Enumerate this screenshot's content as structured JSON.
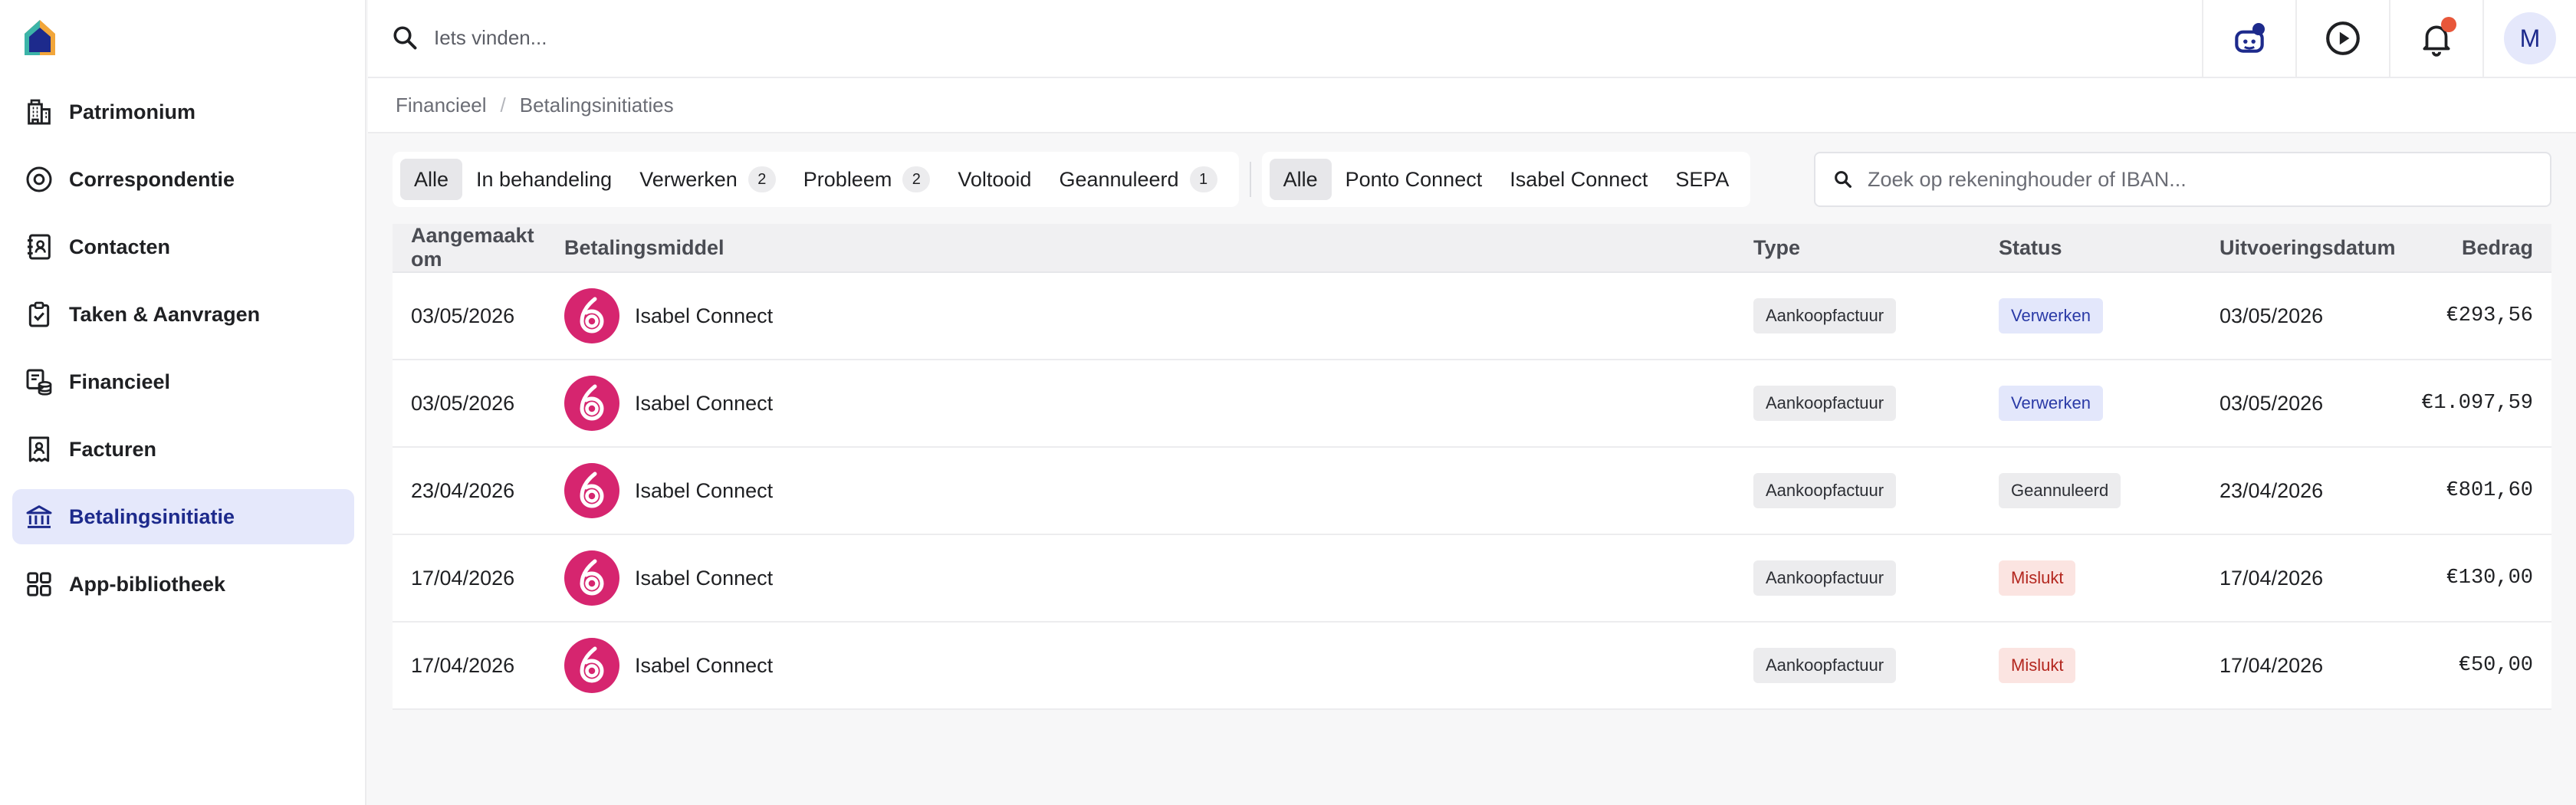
{
  "topbar": {
    "search_placeholder": "Iets vinden...",
    "avatar_initial": "M"
  },
  "sidebar": {
    "items": [
      {
        "label": "Patrimonium",
        "icon": "building-icon",
        "active": false
      },
      {
        "label": "Correspondentie",
        "icon": "at-sign-icon",
        "active": false
      },
      {
        "label": "Contacten",
        "icon": "contact-book-icon",
        "active": false
      },
      {
        "label": "Taken & Aanvragen",
        "icon": "clipboard-check-icon",
        "active": false
      },
      {
        "label": "Financieel",
        "icon": "coins-icon",
        "active": false
      },
      {
        "label": "Facturen",
        "icon": "invoice-icon",
        "active": false
      },
      {
        "label": "Betalingsinitiatie",
        "icon": "bank-icon",
        "active": true
      },
      {
        "label": "App-bibliotheek",
        "icon": "grid-icon",
        "active": false
      }
    ]
  },
  "breadcrumb": {
    "parent": "Financieel",
    "separator": "/",
    "current": "Betalingsinitiaties"
  },
  "filters": {
    "status": [
      {
        "label": "Alle",
        "count": null,
        "selected": true
      },
      {
        "label": "In behandeling",
        "count": null,
        "selected": false
      },
      {
        "label": "Verwerken",
        "count": "2",
        "selected": false
      },
      {
        "label": "Probleem",
        "count": "2",
        "selected": false
      },
      {
        "label": "Voltooid",
        "count": null,
        "selected": false
      },
      {
        "label": "Geannuleerd",
        "count": "1",
        "selected": false
      }
    ],
    "provider": [
      {
        "label": "Alle",
        "selected": true
      },
      {
        "label": "Ponto Connect",
        "selected": false
      },
      {
        "label": "Isabel Connect",
        "selected": false
      },
      {
        "label": "SEPA",
        "selected": false
      }
    ],
    "search_placeholder": "Zoek op rekeninghouder of IBAN..."
  },
  "table": {
    "columns": [
      "Aangemaakt om",
      "Betalingsmiddel",
      "Type",
      "Status",
      "Uitvoeringsdatum",
      "Bedrag"
    ],
    "rows": [
      {
        "created": "03/05/2026",
        "method": "Isabel Connect",
        "type": "Aankoopfactuur",
        "status": "Verwerken",
        "status_kind": "processing",
        "execution_date": "03/05/2026",
        "amount": "€293,56"
      },
      {
        "created": "03/05/2026",
        "method": "Isabel Connect",
        "type": "Aankoopfactuur",
        "status": "Verwerken",
        "status_kind": "processing",
        "execution_date": "03/05/2026",
        "amount": "€1.097,59"
      },
      {
        "created": "23/04/2026",
        "method": "Isabel Connect",
        "type": "Aankoopfactuur",
        "status": "Geannuleerd",
        "status_kind": "cancelled",
        "execution_date": "23/04/2026",
        "amount": "€801,60"
      },
      {
        "created": "17/04/2026",
        "method": "Isabel Connect",
        "type": "Aankoopfactuur",
        "status": "Mislukt",
        "status_kind": "failed",
        "execution_date": "17/04/2026",
        "amount": "€130,00"
      },
      {
        "created": "17/04/2026",
        "method": "Isabel Connect",
        "type": "Aankoopfactuur",
        "status": "Mislukt",
        "status_kind": "failed",
        "execution_date": "17/04/2026",
        "amount": "€50,00"
      }
    ]
  },
  "colors": {
    "active_nav_bg": "#e5e8fb",
    "active_nav_text": "#1d2a8c",
    "isabel_brand": "#d6256f",
    "status_processing_bg": "#e3e7fb",
    "status_processing_text": "#2a3aa6",
    "status_cancelled_bg": "#ececee",
    "status_cancelled_text": "#2d2f35",
    "status_failed_bg": "#fbe4e1",
    "status_failed_text": "#b3261e",
    "notification_dot": "#e8573a",
    "assistant_dot": "#1d2a8c"
  }
}
